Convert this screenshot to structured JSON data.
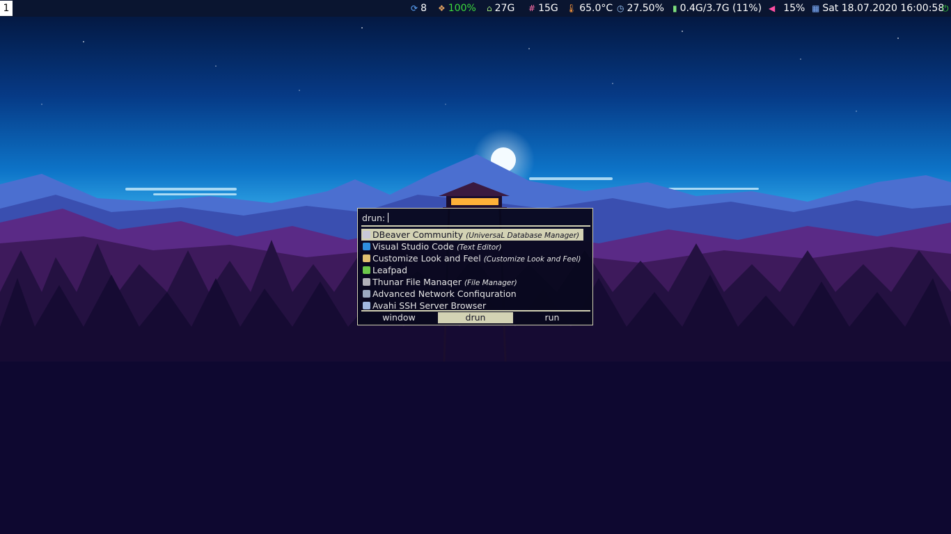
{
  "topbar": {
    "workspace": "1",
    "updates": {
      "icon": "refresh-icon",
      "value": "8"
    },
    "cpu": {
      "icon": "cpu-icon",
      "value": "100%",
      "color": "#3ddc3d"
    },
    "home_disk": {
      "icon": "home-icon",
      "value": "27G"
    },
    "root_disk": {
      "icon": "hash-icon",
      "value": "15G"
    },
    "temperature": {
      "icon": "thermometer-icon",
      "value": "65.0°C"
    },
    "load": {
      "icon": "gauge-icon",
      "value": "27.50%"
    },
    "memory": {
      "icon": "memory-icon",
      "value": "0.4G/3.7G (11%)"
    },
    "volume": {
      "icon": "speaker-icon",
      "value": "15%",
      "color": "#ff4fa3"
    },
    "clock": {
      "icon": "calendar-icon",
      "value": "Sat 18.07.2020 16:00:58"
    },
    "power": {
      "icon": "power-icon",
      "color": "#3ddc3d"
    }
  },
  "rofi": {
    "prompt": "drun:",
    "input_value": "",
    "items": [
      {
        "name": "DBeaver Community",
        "desc": "(UniversaL Database Manager)",
        "icon": "dbeaver-icon",
        "selected": true
      },
      {
        "name": "Visual Studio Code",
        "desc": "(Text Editor)",
        "icon": "vscode-icon",
        "selected": false
      },
      {
        "name": "Customize Look and Feel",
        "desc": "(Customize Look and Feel)",
        "icon": "appearance-icon",
        "selected": false
      },
      {
        "name": "Leafpad",
        "desc": "",
        "icon": "leafpad-icon",
        "selected": false
      },
      {
        "name": "Thunar File Manaqer",
        "desc": "(File Manager)",
        "icon": "file-manager-icon",
        "selected": false
      },
      {
        "name": "Advanced Network Confiquration",
        "desc": "",
        "icon": "network-icon",
        "selected": false
      },
      {
        "name": "Avahi SSH Server Browser",
        "desc": "",
        "icon": "ssh-icon",
        "selected": false
      }
    ],
    "modes": [
      "window",
      "drun",
      "run"
    ],
    "active_mode": "drun"
  },
  "colors": {
    "accent": "#d3d2b4",
    "bar_bg": "#0a1530"
  }
}
